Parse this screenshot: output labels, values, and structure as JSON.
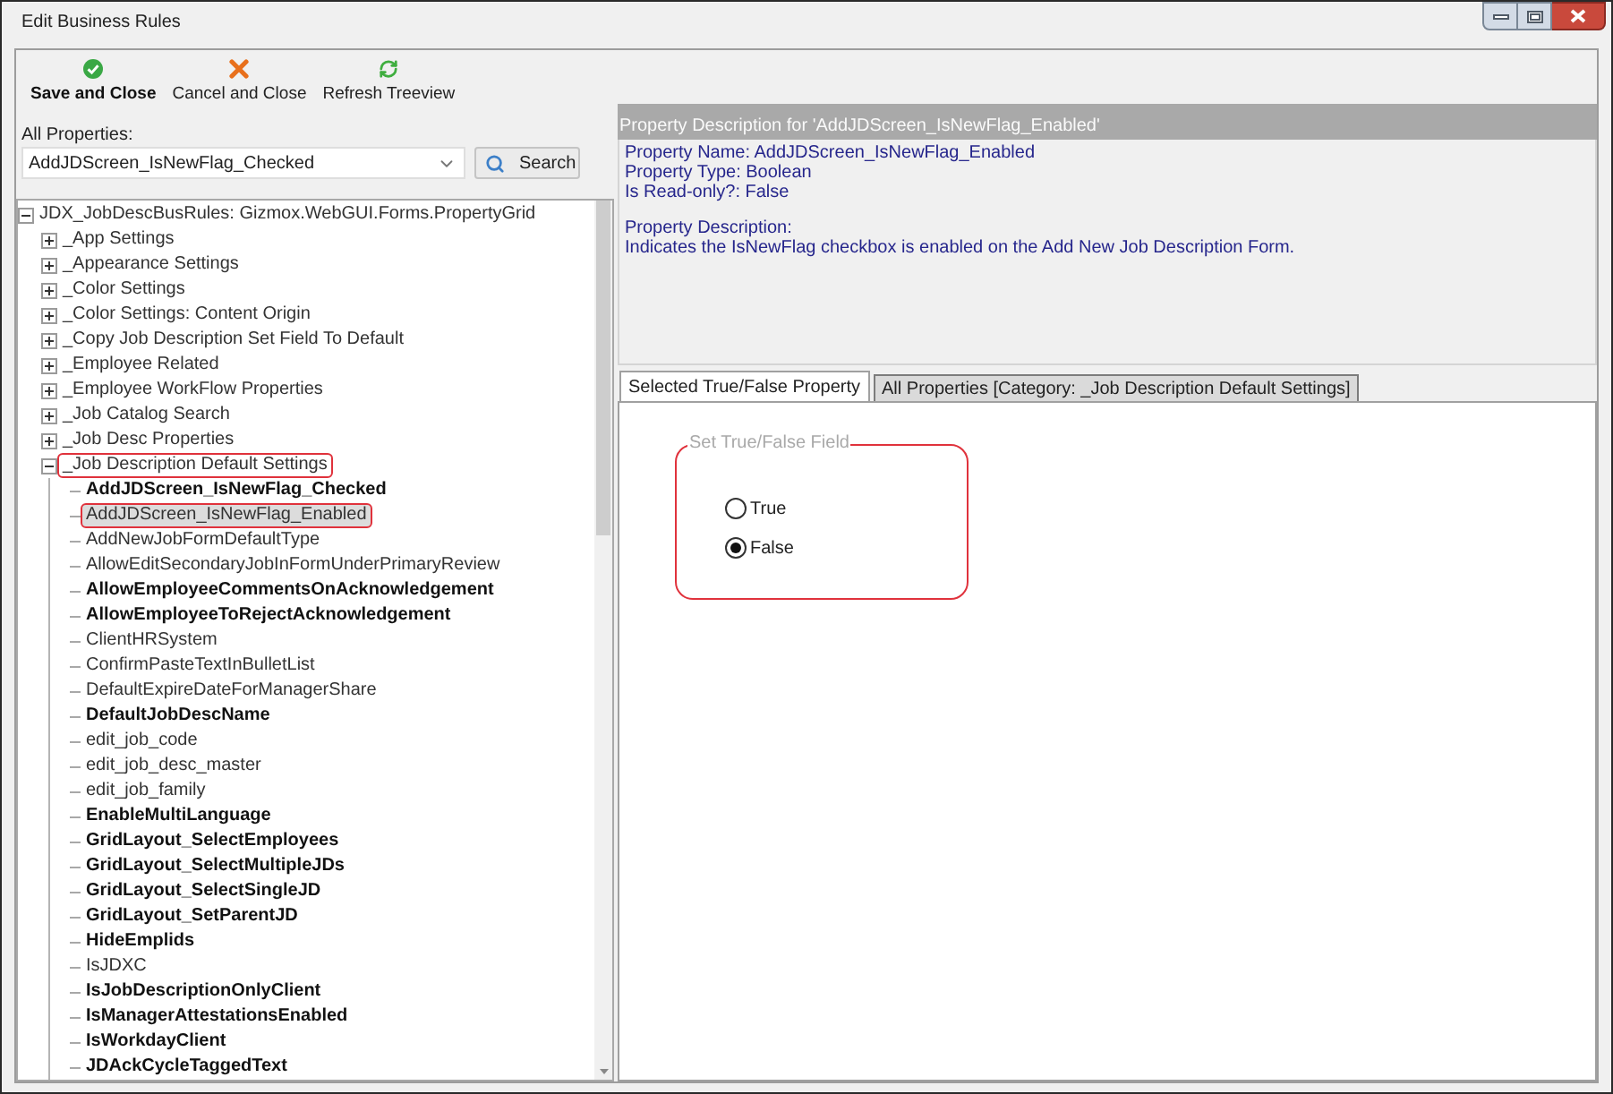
{
  "window": {
    "title": "Edit Business Rules"
  },
  "toolbar": [
    {
      "kind": "save",
      "label": "Save and Close",
      "bold": true
    },
    {
      "kind": "cancel",
      "label": "Cancel and Close",
      "bold": false
    },
    {
      "kind": "refresh",
      "label": "Refresh Treeview",
      "bold": false
    }
  ],
  "properties_filter": {
    "label": "All Properties:",
    "value": "AddJDScreen_IsNewFlag_Checked",
    "button": "Search"
  },
  "tree": {
    "label": "JDX_JobDescBusRules: Gizmox.WebGUI.Forms.PropertyGrid",
    "expanded": true,
    "selected": false,
    "outlined": false,
    "children": [
      {
        "label": "_App Settings",
        "expanded": false,
        "selected": false,
        "outlined": false
      },
      {
        "label": "_Appearance Settings",
        "expanded": false,
        "selected": false,
        "outlined": false
      },
      {
        "label": "_Color Settings",
        "expanded": false,
        "selected": false,
        "outlined": false
      },
      {
        "label": "_Color Settings: Content Origin",
        "expanded": false,
        "selected": false,
        "outlined": false
      },
      {
        "label": "_Copy Job Description Set Field To Default",
        "expanded": false,
        "selected": false,
        "outlined": false
      },
      {
        "label": "_Employee Related",
        "expanded": false,
        "selected": false,
        "outlined": false
      },
      {
        "label": "_Employee WorkFlow Properties",
        "expanded": false,
        "selected": false,
        "outlined": false
      },
      {
        "label": "_Job Catalog Search",
        "expanded": false,
        "selected": false,
        "outlined": false
      },
      {
        "label": "_Job Desc Properties",
        "expanded": false,
        "selected": false,
        "outlined": false
      },
      {
        "label": "_Job Description Default Settings",
        "expanded": true,
        "selected": false,
        "outlined": true,
        "children": [
          {
            "label": "AddJDScreen_IsNewFlag_Checked",
            "bold": true,
            "selected": false,
            "outlined": false
          },
          {
            "label": "AddJDScreen_IsNewFlag_Enabled",
            "bold": false,
            "selected": true,
            "outlined": true
          },
          {
            "label": "AddNewJobFormDefaultType",
            "bold": false,
            "selected": false,
            "outlined": false
          },
          {
            "label": "AllowEditSecondaryJobInFormUnderPrimaryReview",
            "bold": false,
            "selected": false,
            "outlined": false
          },
          {
            "label": "AllowEmployeeCommentsOnAcknowledgement",
            "bold": true,
            "selected": false,
            "outlined": false
          },
          {
            "label": "AllowEmployeeToRejectAcknowledgement",
            "bold": true,
            "selected": false,
            "outlined": false
          },
          {
            "label": "ClientHRSystem",
            "bold": false,
            "selected": false,
            "outlined": false
          },
          {
            "label": "ConfirmPasteTextInBulletList",
            "bold": false,
            "selected": false,
            "outlined": false
          },
          {
            "label": "DefaultExpireDateForManagerShare",
            "bold": false,
            "selected": false,
            "outlined": false
          },
          {
            "label": "DefaultJobDescName",
            "bold": true,
            "selected": false,
            "outlined": false
          },
          {
            "label": "edit_job_code",
            "bold": false,
            "selected": false,
            "outlined": false
          },
          {
            "label": "edit_job_desc_master",
            "bold": false,
            "selected": false,
            "outlined": false
          },
          {
            "label": "edit_job_family",
            "bold": false,
            "selected": false,
            "outlined": false
          },
          {
            "label": "EnableMultiLanguage",
            "bold": true,
            "selected": false,
            "outlined": false
          },
          {
            "label": "GridLayout_SelectEmployees",
            "bold": true,
            "selected": false,
            "outlined": false
          },
          {
            "label": "GridLayout_SelectMultipleJDs",
            "bold": true,
            "selected": false,
            "outlined": false
          },
          {
            "label": "GridLayout_SelectSingleJD",
            "bold": true,
            "selected": false,
            "outlined": false
          },
          {
            "label": "GridLayout_SetParentJD",
            "bold": true,
            "selected": false,
            "outlined": false
          },
          {
            "label": "HideEmplids",
            "bold": true,
            "selected": false,
            "outlined": false
          },
          {
            "label": "IsJDXC",
            "bold": false,
            "selected": false,
            "outlined": false
          },
          {
            "label": "IsJobDescriptionOnlyClient",
            "bold": true,
            "selected": false,
            "outlined": false
          },
          {
            "label": "IsManagerAttestationsEnabled",
            "bold": true,
            "selected": false,
            "outlined": false
          },
          {
            "label": "IsWorkdayClient",
            "bold": true,
            "selected": false,
            "outlined": false
          },
          {
            "label": "JDAckCycleTaggedText",
            "bold": true,
            "selected": false,
            "outlined": false
          }
        ]
      }
    ]
  },
  "description": {
    "title": "Property Description for 'AddJDScreen_IsNewFlag_Enabled'",
    "details": [
      "Property Name: AddJDScreen_IsNewFlag_Enabled",
      "Property Type: Boolean",
      "Is Read-only?: False"
    ],
    "heading": "Property Description:",
    "text": "Indicates the IsNewFlag checkbox is enabled on the Add New Job Description Form."
  },
  "tabs": [
    {
      "label": "Selected True/False Property",
      "selected": true
    },
    {
      "label": "All Properties [Category: _Job Description Default Settings]",
      "selected": false
    }
  ],
  "true_false_field": {
    "legend": "Set True/False Field",
    "outlined": true,
    "options": [
      {
        "label": "True",
        "selected": false
      },
      {
        "label": "False",
        "selected": true
      }
    ]
  }
}
